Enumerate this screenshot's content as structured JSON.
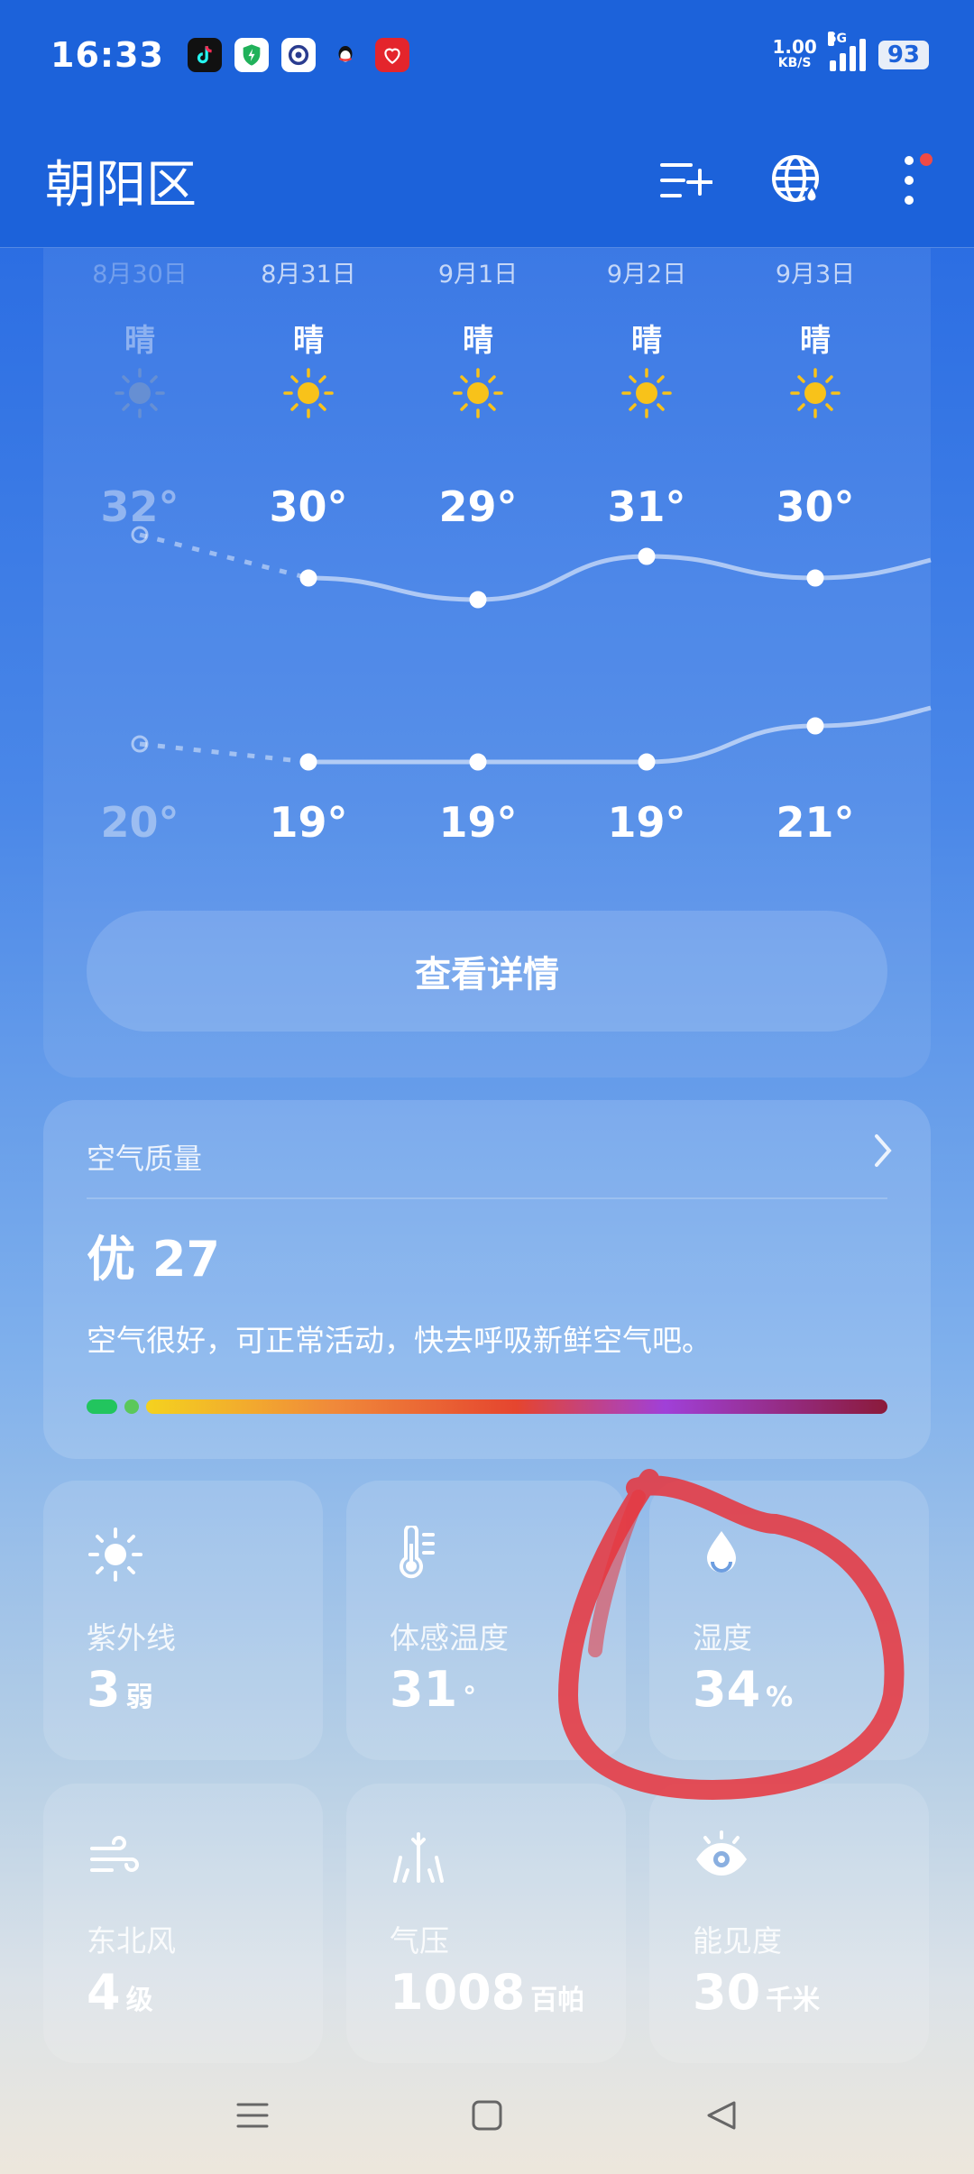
{
  "status_bar": {
    "time": "16:33",
    "net_speed": "1.00",
    "net_unit": "KB/S",
    "network": "5G",
    "battery": "93",
    "app_icons": [
      "douyin-icon",
      "shield-app-icon",
      "baidu-netdisk-icon",
      "qq-icon",
      "xiaohongshu-icon"
    ]
  },
  "header": {
    "city": "朝阳区",
    "actions": [
      "add-city-icon",
      "globe-icon",
      "more-vertical-icon"
    ]
  },
  "forecast": {
    "days": [
      {
        "date": "8月30日",
        "cond": "晴",
        "high": "32°",
        "low": "20°"
      },
      {
        "date": "8月31日",
        "cond": "晴",
        "high": "30°",
        "low": "19°"
      },
      {
        "date": "9月1日",
        "cond": "晴",
        "high": "29°",
        "low": "19°"
      },
      {
        "date": "9月2日",
        "cond": "晴",
        "high": "31°",
        "low": "19°"
      },
      {
        "date": "9月3日",
        "cond": "晴",
        "high": "30°",
        "low": "21°"
      }
    ],
    "details_label": "查看详情"
  },
  "chart_data": {
    "type": "line",
    "categories": [
      "8月30日",
      "8月31日",
      "9月1日",
      "9月2日",
      "9月3日"
    ],
    "series": [
      {
        "values": [
          32,
          30,
          29,
          31,
          30
        ]
      },
      {
        "values": [
          20,
          19,
          19,
          19,
          21
        ]
      }
    ]
  },
  "air_quality": {
    "title": "空气质量",
    "level": "优",
    "aqi": "27",
    "description": "空气很好，可正常活动，快去呼吸新鲜空气吧。"
  },
  "tiles": {
    "uv": {
      "label": "紫外线",
      "value": "3",
      "unit": "弱"
    },
    "feels_like": {
      "label": "体感温度",
      "value": "31",
      "unit": "°"
    },
    "humidity": {
      "label": "湿度",
      "value": "34",
      "unit": "%"
    },
    "wind": {
      "label": "东北风",
      "value": "4",
      "unit": "级"
    },
    "pressure": {
      "label": "气压",
      "value": "1008",
      "unit": "百帕"
    },
    "visibility": {
      "label": "能见度",
      "value": "30",
      "unit": "千米"
    }
  },
  "colors": {
    "header_bg": "#1c62da",
    "sun": "#f8c21a",
    "annotation": "#e8343c"
  }
}
